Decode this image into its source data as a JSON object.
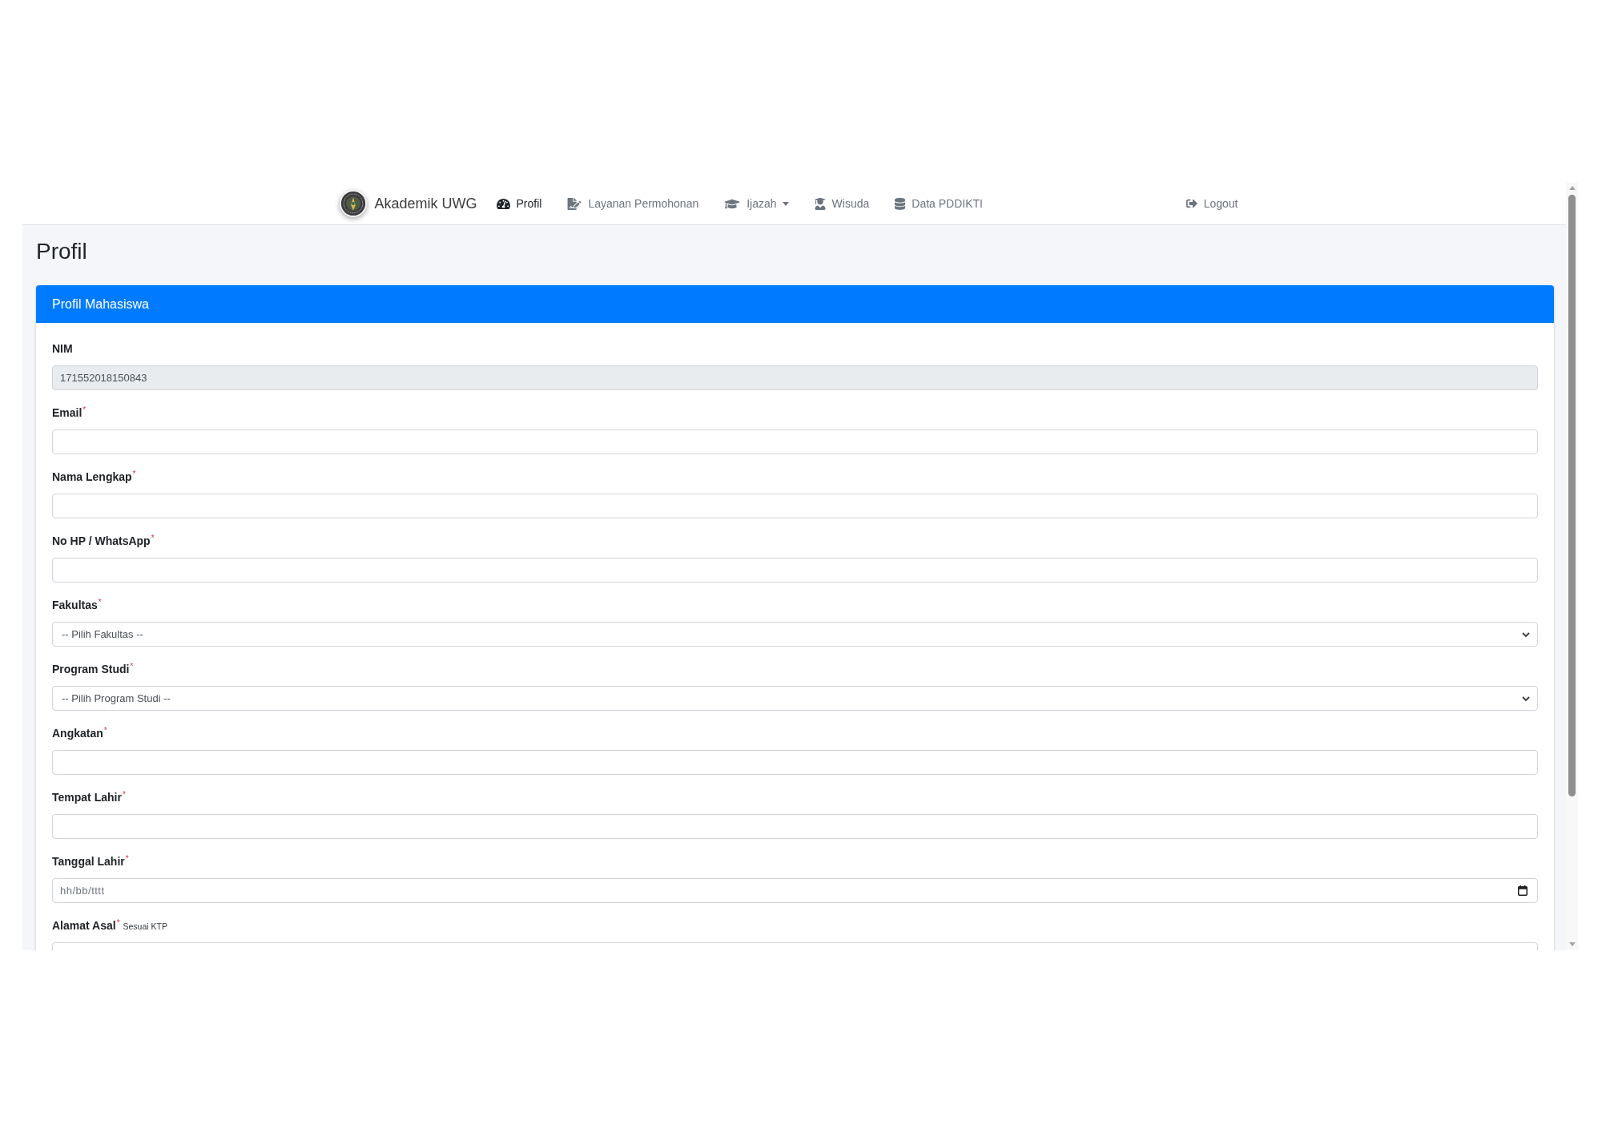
{
  "navbar": {
    "brand": "Akademik UWG",
    "items": [
      {
        "label": "Profil",
        "kind": "link",
        "selected": true
      },
      {
        "label": "Layanan Permohonan",
        "kind": "link",
        "selected": false
      },
      {
        "label": "Ijazah",
        "kind": "dropdown",
        "selected": false
      },
      {
        "label": "Wisuda",
        "kind": "link",
        "selected": false
      },
      {
        "label": "Data PDDIKTI",
        "kind": "link",
        "selected": false
      }
    ],
    "logout": {
      "label": "Logout"
    }
  },
  "page_title": "Profil",
  "card": {
    "title": "Profil Mahasiswa",
    "fields": [
      {
        "kind": "text",
        "label": "NIM",
        "value": "171552018150843",
        "disabled": true
      },
      {
        "kind": "text",
        "label": "Email$^{*}$",
        "disabled": false
      },
      {
        "kind": "text",
        "label": "Nama Lengkap$^{*}$",
        "disabled": false
      },
      {
        "kind": "text",
        "label": "No HP / WhatsApp$^{*}$",
        "disabled": false
      },
      {
        "kind": "select",
        "label": "Fakultas$^{*}$",
        "value": "-- Pilih Fakultas --",
        "disabled": false
      },
      {
        "kind": "select",
        "label": "Program Studi$^{*}$",
        "value": "-- Pilih Program Studi --",
        "disabled": false
      },
      {
        "kind": "text",
        "label": "Angkatan$^{*}$",
        "disabled": false
      },
      {
        "kind": "text",
        "label": "Tempat Lahir$^{*}$",
        "disabled": false
      },
      {
        "kind": "date",
        "label": "Tanggal Lahir$^{*}$",
        "placeholder": "hh/bb/tttt",
        "disabled": false
      },
      {
        "kind": "text",
        "label": "Alamat Asal$^{*}$",
        "note": "Sesuai KTP",
        "disabled": false
      }
    ]
  }
}
